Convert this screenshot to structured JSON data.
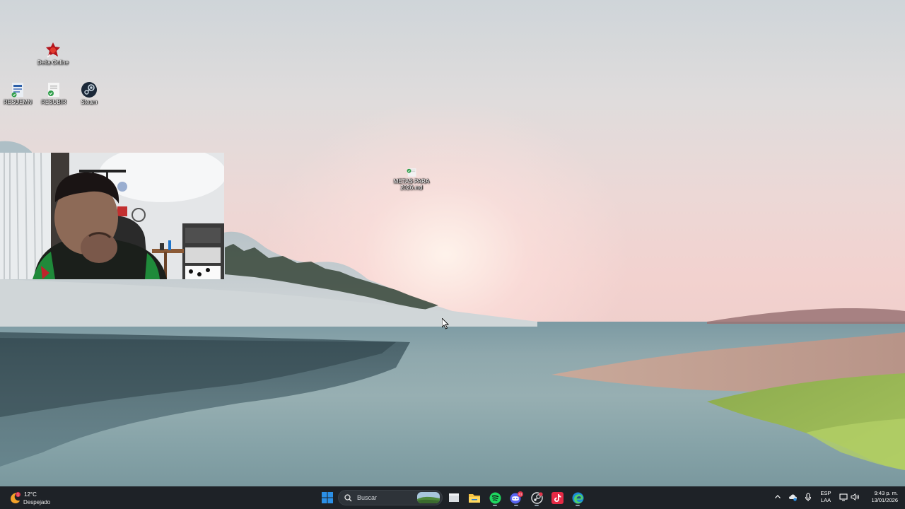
{
  "desktop": {
    "icons": [
      {
        "label": "Delta Online",
        "icon": "delta-online-icon"
      },
      {
        "label": "RESUEMN",
        "icon": "document-icon"
      },
      {
        "label": "RESUBIR",
        "icon": "document-check-icon"
      },
      {
        "label": "Steam",
        "icon": "steam-icon"
      },
      {
        "label": "METAS PARA 2026.md",
        "icon": "markdown-file-icon"
      }
    ]
  },
  "taskbar": {
    "weather": {
      "temp": "12°C",
      "condition": "Despejado"
    },
    "search": {
      "placeholder": "Buscar"
    },
    "pinned": [
      "start-icon",
      "search-icon",
      "file-explorer-icon",
      "spotify-icon",
      "discord-icon",
      "steam-icon",
      "tiktok-icon",
      "edge-icon"
    ],
    "language": {
      "line1": "ESP",
      "line2": "LAA"
    },
    "clock": {
      "time": "9:43 p. m.",
      "date": "13/01/2026"
    },
    "discord_badge": "61"
  },
  "colors": {
    "taskbar_bg": "#1e2227",
    "windows_blue": "#2b8fe6",
    "spotify_green": "#1ed760",
    "discord_blurple": "#5865f2",
    "tiktok_red": "#e52a45"
  }
}
